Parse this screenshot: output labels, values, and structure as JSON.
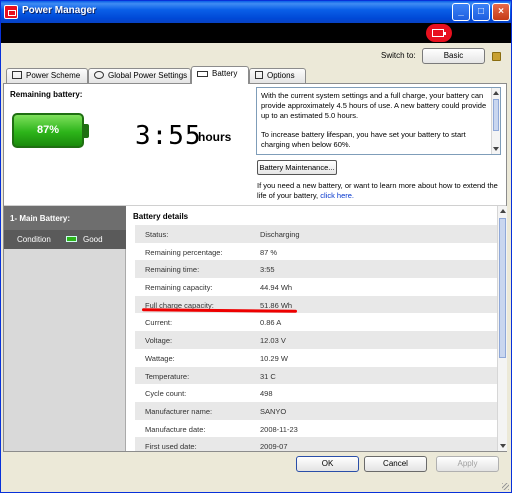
{
  "window": {
    "title": "Power Manager",
    "controls": {
      "minimize": "_",
      "maximize": "□",
      "close": "×"
    }
  },
  "header": {
    "switch_label": "Switch to:",
    "switch_button": "Basic"
  },
  "tabs": [
    {
      "label": "Power Scheme",
      "icon": "power-scheme-icon",
      "active": false
    },
    {
      "label": "Global Power Settings",
      "icon": "gear-icon",
      "active": false
    },
    {
      "label": "Battery",
      "icon": "battery-icon",
      "active": true
    },
    {
      "label": "Options",
      "icon": "checkbox-icon",
      "active": false
    }
  ],
  "battery": {
    "remaining_label": "Remaining battery:",
    "percent_display": "87%",
    "percent_value": 87,
    "time_display": "3:55",
    "time_unit": "hours",
    "info_paragraph_1": "With the current system settings and a full charge, your battery can provide approximately 4.5 hours of use. A new battery could provide up to an estimated 5.0 hours.",
    "info_paragraph_2": "To increase battery lifespan, you have set your battery to start charging when below 60%.",
    "maintenance_button": "Battery Maintenance...",
    "extend_text": "If you need a new battery, or want to learn more about how to extend the life of your battery,",
    "extend_link": "click here."
  },
  "sidebar": {
    "main_battery_label": "1- Main Battery:",
    "condition_label": "Condition",
    "condition_value": "Good"
  },
  "details": {
    "title": "Battery details",
    "rows": [
      {
        "key": "Status:",
        "value": "Discharging"
      },
      {
        "key": "Remaining percentage:",
        "value": "87 %"
      },
      {
        "key": "Remaining time:",
        "value": "3:55"
      },
      {
        "key": "Remaining capacity:",
        "value": "44.94 Wh"
      },
      {
        "key": "Full charge capacity:",
        "value": "51.86 Wh"
      },
      {
        "key": "Current:",
        "value": "0.86 A"
      },
      {
        "key": "Voltage:",
        "value": "12.03 V"
      },
      {
        "key": "Wattage:",
        "value": "10.29 W"
      },
      {
        "key": "Temperature:",
        "value": "31 C"
      },
      {
        "key": "Cycle count:",
        "value": "498"
      },
      {
        "key": "Manufacturer name:",
        "value": "SANYO"
      },
      {
        "key": "Manufacture date:",
        "value": "2008-11-23"
      },
      {
        "key": "First used date:",
        "value": "2009-07"
      }
    ]
  },
  "footer": {
    "ok": "OK",
    "cancel": "Cancel",
    "apply": "Apply"
  },
  "colors": {
    "accent": "#e8101e",
    "battery_green": "#2db41a",
    "title_blue": "#0a5fe8",
    "annotation_red": "#e00000"
  }
}
